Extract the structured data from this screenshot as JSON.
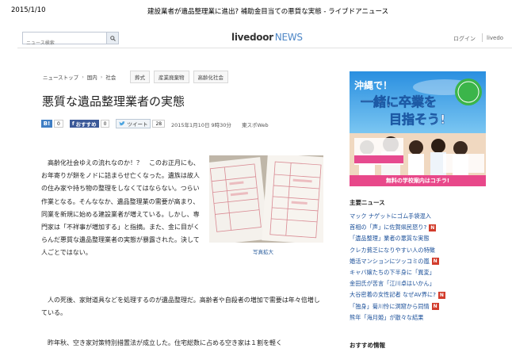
{
  "print": {
    "date": "2015/1/10",
    "title": "建設業者が遺品整理業に進出? 補助金目当ての悪質な実態 - ライブドアニュース"
  },
  "header": {
    "search_placeholder": "ニュース検索",
    "logo_main": "livedoor",
    "logo_news": "NEWS",
    "login": "ログイン",
    "livedoor_link": "livedo"
  },
  "breadcrumb": [
    "ニューストップ",
    "国内",
    "社会"
  ],
  "tags": [
    "葬式",
    "産業廃棄物",
    "高齢化社会"
  ],
  "article": {
    "headline": "悪質な遺品整理業者の実態",
    "share": {
      "b_count": "0",
      "fb_label": "おすすめ",
      "fb_count": "0",
      "tw_label": "ツイート",
      "tw_count": "28"
    },
    "date": "2015年1月10日 9時30分",
    "source": "東スポWeb",
    "para1": "　高齢化社会ゆえの流れなのか！？　このお正月にも、お年寄りが餅をノドに詰まらせ亡くなった。遺族は故人の住み家や持ち物の整理をしなくてはならない。つらい作業となる。そんななか、遺品整理業の需要が高まり、同業を新規に始める建設業者が増えている。しかし、専門家は「不祥事が増加する」と指摘。また、金に目がくらんだ悪質な遺品整理業者の実態が暴露された。決して人ごとではない。",
    "photo_caption": "写真拡大",
    "para2": "　人の死後、家財道具などを処理するのが遺品整理だ。高齢者や自殺者の増加で需要は年々倍増している。",
    "para3": "　昨年秋、空き家対策特別措置法が成立した。住宅総数に占める空き家は１割を軽く"
  },
  "ad": {
    "tagline": "沖縄で！一緒に卒業を目指そう!",
    "bottom": "無料の学校案内はコチラ!"
  },
  "sidebar": {
    "title": "主要ニュース",
    "title2": "おすすめ情報",
    "items": [
      {
        "text": "マック ナゲットにゴム手袋混入",
        "new": false
      },
      {
        "text": "首相の「声」に佐賀県民怒り?",
        "new": true
      },
      {
        "text": "「遺品整理」業者の悪質な実態",
        "new": false
      },
      {
        "text": "クレカ貧乏になりやすい人の特徴",
        "new": false
      },
      {
        "text": "婚活マンションにツッコミの嵐",
        "new": true
      },
      {
        "text": "キャバ嬢たちの下半身に「異変」",
        "new": false
      },
      {
        "text": "金田氏が苦言「江川卓はいかん」",
        "new": false
      },
      {
        "text": "大谷密着の女性記者 なぜAV界に?",
        "new": true
      },
      {
        "text": "「独身」菊川怜に洞窟から同情",
        "new": true
      },
      {
        "text": "熊年「海月姫」が散々な結果",
        "new": false
      }
    ]
  }
}
